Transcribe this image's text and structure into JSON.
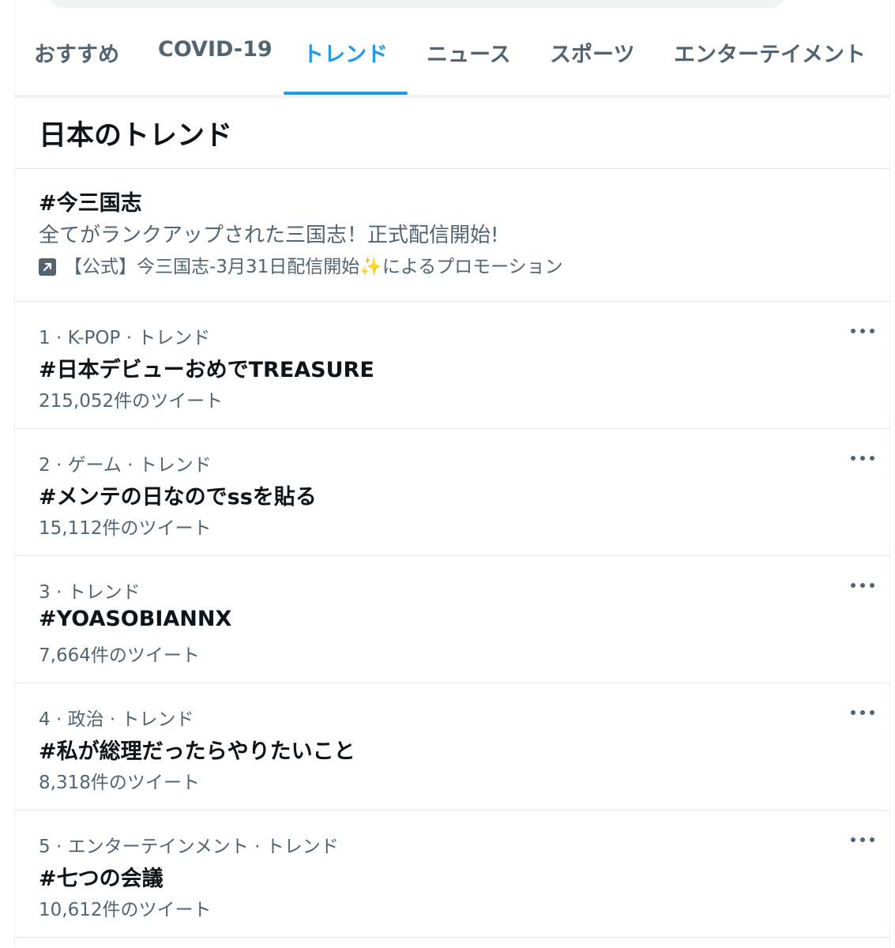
{
  "tabs": [
    {
      "label": "おすすめ"
    },
    {
      "label": "COVID-19"
    },
    {
      "label": "トレンド"
    },
    {
      "label": "ニュース"
    },
    {
      "label": "スポーツ"
    },
    {
      "label": "エンターテイメント"
    }
  ],
  "active_tab": "トレンド",
  "section_title": "日本のトレンド",
  "promoted": {
    "title": "#今三国志",
    "description": "全てがランクアップされた三国志！正式配信開始!",
    "promoted_by": "【公式】今三国志-3月31日配信開始✨によるプロモーション",
    "icon": "promoted-arrow-icon"
  },
  "trends": [
    {
      "meta": "1 · K-POP · トレンド",
      "name": "#日本デビューおめでTREASURE",
      "count": "215,052件のツイート"
    },
    {
      "meta": "2 · ゲーム · トレンド",
      "name": "#メンテの日なのでssを貼る",
      "count": "15,112件のツイート"
    },
    {
      "meta": "3 · トレンド",
      "name": "#YOASOBIANNX",
      "count": "7,664件のツイート"
    },
    {
      "meta": "4 · 政治 · トレンド",
      "name": "#私が総理だったらやりたいこと",
      "count": "8,318件のツイート"
    },
    {
      "meta": "5 · エンターテインメント · トレンド",
      "name": "#七つの会議",
      "count": "10,612件のツイート"
    }
  ],
  "colors": {
    "accent": "#1d9bf0",
    "primary_text": "#0f1419",
    "secondary_text": "#536471",
    "divider": "#eff3f4"
  }
}
